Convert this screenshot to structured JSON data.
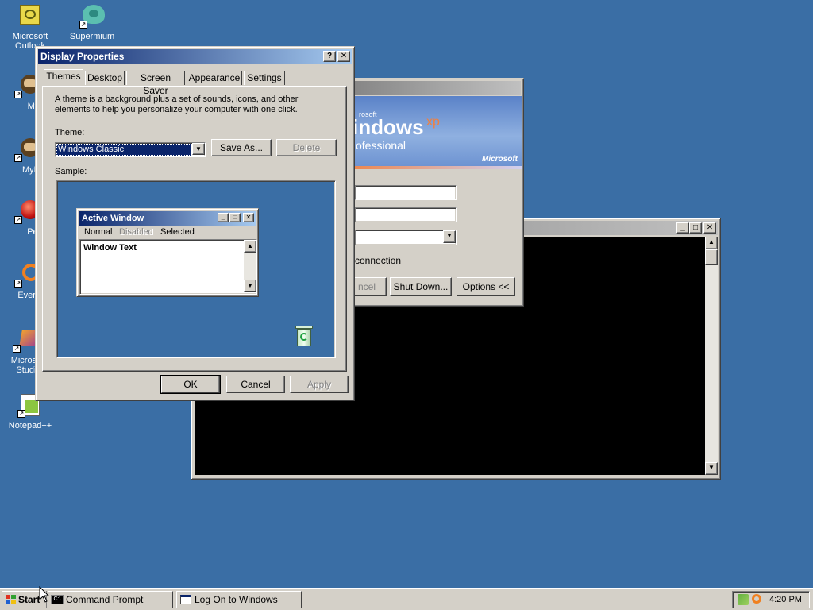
{
  "desktop": {
    "icons": [
      {
        "label": "Microsoft Outlook",
        "icon": "outlook-icon"
      },
      {
        "label": "Supermium",
        "icon": "supermium-icon"
      },
      {
        "label": "Myp",
        "icon": "mypal-icon"
      },
      {
        "label": "MyPa",
        "icon": "mypal-icon"
      },
      {
        "label": "Peg",
        "icon": "pegasus-icon"
      },
      {
        "label": "Everyth",
        "icon": "everything-icon"
      },
      {
        "label": "Microsoft Studio",
        "icon": "visual-studio-icon"
      },
      {
        "label": "Notepad++",
        "icon": "notepadpp-icon"
      }
    ]
  },
  "display_properties": {
    "title": "Display Properties",
    "help_btn": "?",
    "close_btn": "✕",
    "tabs": [
      "Themes",
      "Desktop",
      "Screen Saver",
      "Appearance",
      "Settings"
    ],
    "description": "A theme is a background plus a set of sounds, icons, and other elements to help you personalize your computer with one click.",
    "theme_label": "Theme:",
    "theme_value": "Windows Classic",
    "save_as": "Save As...",
    "delete": "Delete",
    "sample_label": "Sample:",
    "preview": {
      "title": "Active Window",
      "menu": [
        "Normal",
        "Disabled",
        "Selected"
      ],
      "body_text": "Window Text"
    },
    "ok": "OK",
    "cancel": "Cancel",
    "apply": "Apply"
  },
  "logon_dialog": {
    "brand_small": "rosoft",
    "brand_main": "indows",
    "brand_xp": "xp",
    "edition": "ofessional",
    "microsoft": "Microsoft",
    "connection": "connection",
    "cancel_partial": "ncel",
    "shutdown": "Shut Down...",
    "options": "Options <<"
  },
  "taskbar": {
    "start": "Start",
    "tasks": [
      "Command Prompt",
      "Log On to Windows"
    ],
    "clock": "4:20 PM"
  },
  "colors": {
    "desktop": "#3a6ea5",
    "active_title": "#0a246a",
    "face": "#d4d0c8"
  }
}
